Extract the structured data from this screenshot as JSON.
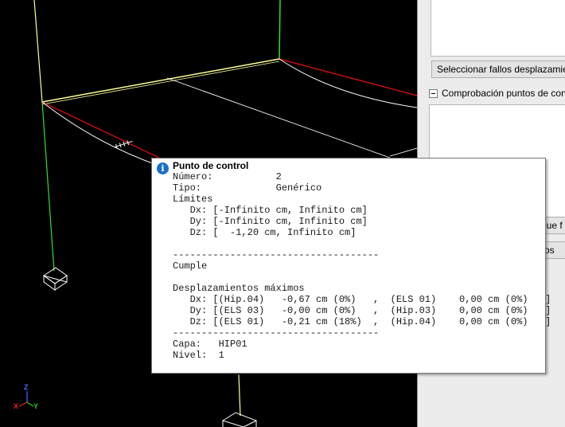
{
  "sidebar": {
    "select_failures_button": "Seleccionar fallos desplazamien",
    "control_points_group": "Comprobación puntos de contro",
    "partial_button_1": "que f",
    "partial_button_2": "os"
  },
  "axis_labels": {
    "z": "Z",
    "x": "X",
    "y": "Y"
  },
  "tooltip": {
    "title": "Punto de control",
    "icon": "info-icon",
    "lines": [
      "Número:           2",
      "Tipo:             Genérico",
      "Límites",
      "   Dx: [-Infinito cm, Infinito cm]",
      "   Dy: [-Infinito cm, Infinito cm]",
      "   Dz: [  -1,20 cm, Infinito cm]",
      "",
      "------------------------------------",
      "Cumple",
      "",
      "Desplazamientos máximos",
      "   Dx: [(Hip.04)   -0,67 cm (0%)   ,  (ELS 01)    0,00 cm (0%)   ]",
      "   Dy: [(ELS 03)   -0,00 cm (0%)   ,  (Hip.03)    0,00 cm (0%)   ]",
      "   Dz: [(ELS 01)   -0,21 cm (18%)  ,  (Hip.04)    0,00 cm (0%)   ]",
      "------------------------------------",
      "Capa:   HIP01",
      "Nivel:  1"
    ]
  },
  "colors": {
    "viewport_bg": "#000000",
    "beam_yellow": "#ffff99",
    "deformed_beam": "#ffffff",
    "column_green": "#33dd33",
    "reaction_red": "#ee1111",
    "info_blue": "#1b6fc7"
  }
}
